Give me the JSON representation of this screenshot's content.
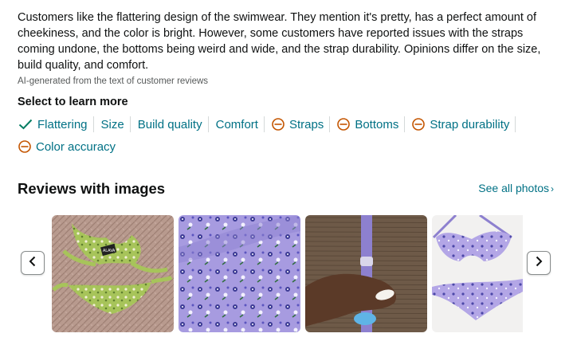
{
  "summary": {
    "text": "Customers like the flattering design of the swimwear. They mention it's pretty, has a perfect amount of cheekiness, and the color is bright. However, some customers have reported issues with the straps coming undone, the bottoms being weird and wide, and the strap durability. Opinions differ on the size, build quality, and comfort.",
    "ai_note": "AI-generated from the text of customer reviews"
  },
  "aspects": {
    "title": "Select to learn more",
    "items": [
      {
        "label": "Flattering",
        "icon": "checkmark-icon"
      },
      {
        "label": "Size",
        "icon": ""
      },
      {
        "label": "Build quality",
        "icon": ""
      },
      {
        "label": "Comfort",
        "icon": ""
      },
      {
        "label": "Straps",
        "icon": "minus-circle-icon"
      },
      {
        "label": "Bottoms",
        "icon": "minus-circle-icon"
      },
      {
        "label": "Strap durability",
        "icon": "minus-circle-icon"
      },
      {
        "label": "Color accuracy",
        "icon": "minus-circle-icon"
      }
    ]
  },
  "reviews_images": {
    "title": "Reviews with images",
    "see_all": "See all photos",
    "see_all_icon": "chevron-right-icon",
    "prev_icon": "chevron-left-icon",
    "next_icon": "chevron-right-icon",
    "photos": [
      {
        "name": "photo-green-floral-bikini-on-rug",
        "label": "ALAVA"
      },
      {
        "name": "photo-lavender-floral-fabric"
      },
      {
        "name": "photo-hand-holding-strap"
      },
      {
        "name": "photo-lavender-bikini-set"
      }
    ]
  },
  "colors": {
    "link": "#007185",
    "text": "#0f1111",
    "muted": "#565959",
    "positive": "#067d62",
    "negative": "#c45500"
  }
}
